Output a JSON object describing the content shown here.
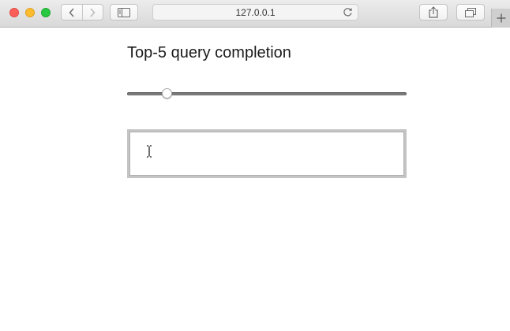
{
  "browser": {
    "address_text": "127.0.0.1",
    "buttons": {
      "back": "chevron-left-icon",
      "forward": "chevron-right-icon",
      "sidebar": "sidebar-icon",
      "reload": "reload-icon",
      "share": "share-icon",
      "tabs": "tabs-overview-icon",
      "new_tab": "plus-icon"
    },
    "traffic_colors": {
      "close": "#fc5f57",
      "minimize": "#fdbc2e",
      "maximize": "#28c840"
    }
  },
  "page": {
    "title": "Top-5 query completion",
    "slider": {
      "fraction": 0.13
    },
    "query_input": {
      "value": ""
    }
  }
}
